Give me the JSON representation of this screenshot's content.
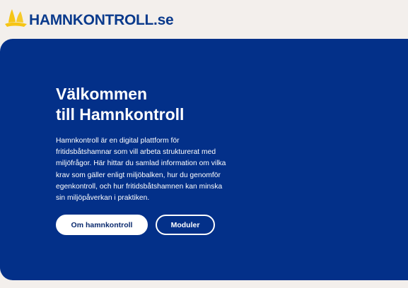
{
  "header": {
    "logo_text": "HAMNKONTROLL.se",
    "logo_icon": "sailboat-icon"
  },
  "hero": {
    "title_line1": "Välkommen",
    "title_line2": "till Hamnkontroll",
    "body_lines": [
      "Hamnkontroll är en digital plattform för",
      "fritidsbåtshamnar som vill arbeta strukturerat med",
      "miljöfrågor. Här hittar du samlad information om vilka",
      "krav som gäller enligt miljöbalken, hur du genomför",
      "egenkontroll, och hur fritidsbåtshamnen kan minska",
      "sin miljöpåverkan i praktiken."
    ],
    "primary_button": "Om hamnkontroll",
    "secondary_button": "Moduler"
  },
  "colors": {
    "brand_blue": "#033089",
    "logo_blue": "#0a3a8c",
    "logo_yellow": "#f6c515",
    "background": "#f3efec"
  }
}
